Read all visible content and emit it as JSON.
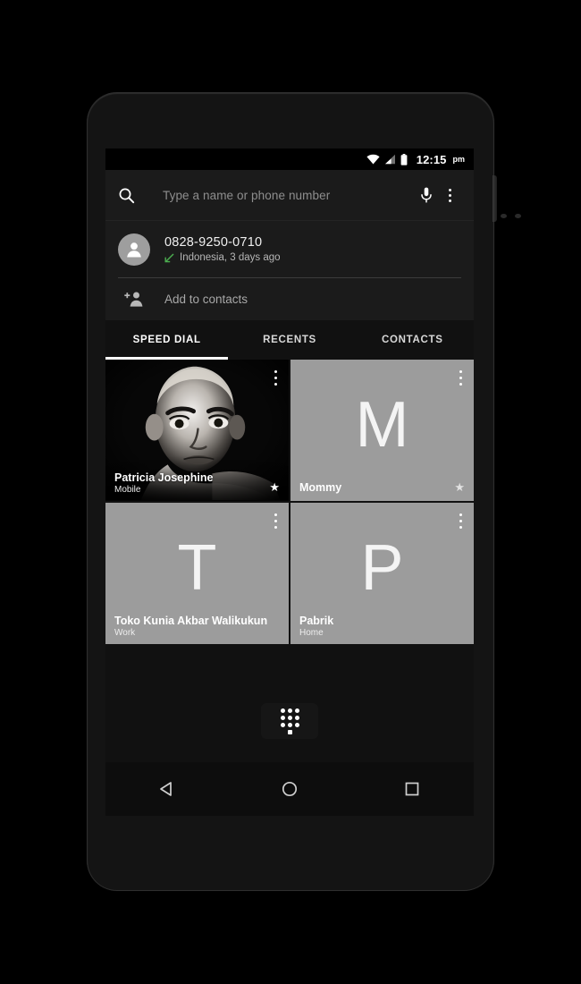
{
  "status_bar": {
    "wifi_icon": "wifi-icon",
    "signal_icon": "cellular-signal-icon",
    "battery_icon": "battery-icon",
    "time": "12:15",
    "am_pm": "pm"
  },
  "search": {
    "search_icon": "search-icon",
    "placeholder": "Type a name or phone number",
    "value": "",
    "mic_icon": "microphone-icon",
    "overflow_icon": "overflow-menu-icon"
  },
  "suggestion": {
    "avatar_icon": "person-avatar-icon",
    "number": "0828-9250-0710",
    "call_direction_icon": "incoming-call-arrow-icon",
    "call_direction_color": "#4caf50",
    "detail": "Indonesia, 3 days ago",
    "add_icon": "add-person-icon",
    "add_label": "Add to contacts"
  },
  "tabs": [
    {
      "label": "SPEED DIAL",
      "active": true
    },
    {
      "label": "RECENTS",
      "active": false
    },
    {
      "label": "CONTACTS",
      "active": false
    }
  ],
  "speed_dial": [
    {
      "name": "Patricia Josephine",
      "type": "Mobile",
      "letter": "",
      "has_photo": true,
      "starred": true,
      "star_icon": "star-icon",
      "menu_icon": "overflow-menu-icon",
      "bg_color": "#050505"
    },
    {
      "name": "Mommy",
      "type": "",
      "letter": "M",
      "has_photo": false,
      "starred": true,
      "star_icon": "star-icon",
      "menu_icon": "overflow-menu-icon",
      "bg_color": "#9c9c9c"
    },
    {
      "name": "Toko Kunia Akbar Walikukun",
      "type": "Work",
      "letter": "T",
      "has_photo": false,
      "starred": false,
      "star_icon": "star-icon",
      "menu_icon": "overflow-menu-icon",
      "bg_color": "#9c9c9c"
    },
    {
      "name": "Pabrik",
      "type": "Home",
      "letter": "P",
      "has_photo": false,
      "starred": false,
      "star_icon": "star-icon",
      "menu_icon": "overflow-menu-icon",
      "bg_color": "#9c9c9c"
    }
  ],
  "dial_button": {
    "icon": "dialpad-icon",
    "label": "Dialpad"
  },
  "nav_bar": {
    "back_icon": "back-triangle-icon",
    "home_icon": "home-circle-icon",
    "recents_icon": "recents-square-icon"
  },
  "device": {
    "camera_icon": "front-camera-icon",
    "earpiece_icon": "earpiece-speaker-icon",
    "sensor_icon": "proximity-sensor-icon",
    "power_button": "power-button"
  }
}
